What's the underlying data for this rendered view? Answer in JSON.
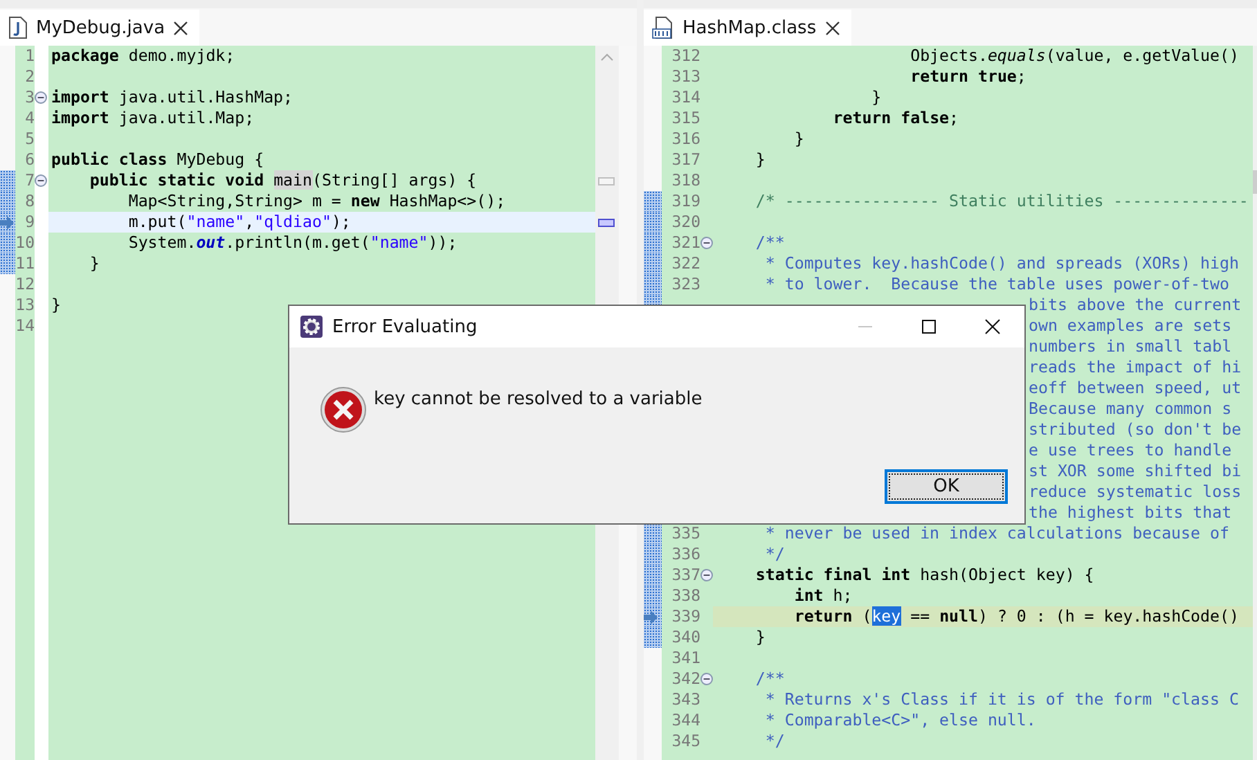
{
  "editors": [
    {
      "tab": {
        "title": "MyDebug.java",
        "kind": "java"
      },
      "scrollbar": {
        "kind": "overview"
      },
      "lines": [
        {
          "n": "1",
          "fold": false,
          "current": false,
          "scope": false,
          "parts": [
            {
              "text": "**package** demo.myjdk;",
              "kind": "code"
            }
          ]
        },
        {
          "n": "2",
          "fold": false,
          "current": false,
          "scope": false
        },
        {
          "n": "3",
          "fold": true,
          "current": false,
          "scope": false,
          "parts": [
            {
              "text": "**import** java.util.HashMap;",
              "kind": "code"
            }
          ]
        },
        {
          "n": "4",
          "fold": false,
          "current": false,
          "scope": false,
          "parts": [
            {
              "text": "**import** java.util.Map;",
              "kind": "code"
            }
          ]
        },
        {
          "n": "5",
          "fold": false,
          "current": false,
          "scope": false
        },
        {
          "n": "6",
          "fold": false,
          "current": false,
          "scope": false,
          "parts": [
            {
              "text": "**public** **class** MyDebug {",
              "kind": "code"
            }
          ]
        },
        {
          "n": "7",
          "fold": true,
          "current": false,
          "scope": true,
          "parts": [
            {
              "text": "    **public** **static** **void** ",
              "kind": "code"
            },
            {
              "text": "main",
              "kind": "occurrence"
            },
            {
              "text": "(String[] args) {",
              "kind": "code"
            }
          ]
        },
        {
          "n": "8",
          "fold": false,
          "current": false,
          "scope": true,
          "parts": [
            {
              "text": "        Map<String,String> m = **new** HashMap<>();",
              "kind": "code"
            }
          ]
        },
        {
          "n": "9",
          "fold": false,
          "current": true,
          "scope": true,
          "parts": [
            {
              "text": "        m.put(\"name\",\"qldiao\");",
              "kind": "code"
            }
          ]
        },
        {
          "n": "10",
          "fold": false,
          "current": false,
          "scope": true,
          "parts": [
            {
              "text": "        System.",
              "kind": "code"
            },
            {
              "text": "out",
              "kind": "field"
            },
            {
              "text": ".println(m.get(\"name\"));",
              "kind": "code"
            }
          ]
        },
        {
          "n": "11",
          "fold": false,
          "current": false,
          "scope": true,
          "parts": [
            {
              "text": "    }",
              "kind": "code"
            }
          ]
        },
        {
          "n": "12",
          "fold": false,
          "current": false,
          "scope": false
        },
        {
          "n": "13",
          "fold": false,
          "current": false,
          "scope": false,
          "parts": [
            {
              "text": "}",
              "kind": "code"
            }
          ]
        },
        {
          "n": "14",
          "fold": false,
          "current": false,
          "scope": false
        }
      ]
    },
    {
      "tab": {
        "title": "HashMap.class",
        "kind": "class"
      },
      "scrollbar": {
        "kind": "thumb"
      },
      "lines": [
        {
          "n": "312",
          "fold": false,
          "current": false,
          "scope": false,
          "parts": [
            {
              "text": "                    Objects.*equals*(value, e.getValue()",
              "kind": "code"
            }
          ]
        },
        {
          "n": "313",
          "fold": false,
          "current": false,
          "scope": false,
          "parts": [
            {
              "text": "                    **return** **true**;",
              "kind": "code"
            }
          ]
        },
        {
          "n": "314",
          "fold": false,
          "current": false,
          "scope": false,
          "parts": [
            {
              "text": "                }",
              "kind": "code"
            }
          ]
        },
        {
          "n": "315",
          "fold": false,
          "current": false,
          "scope": false,
          "parts": [
            {
              "text": "            **return** **false**;",
              "kind": "code"
            }
          ]
        },
        {
          "n": "316",
          "fold": false,
          "current": false,
          "scope": false,
          "parts": [
            {
              "text": "        }",
              "kind": "code"
            }
          ]
        },
        {
          "n": "317",
          "fold": false,
          "current": false,
          "scope": false,
          "parts": [
            {
              "text": "    }",
              "kind": "code"
            }
          ]
        },
        {
          "n": "318",
          "fold": false,
          "current": false,
          "scope": false
        },
        {
          "n": "319",
          "fold": false,
          "current": false,
          "scope": true,
          "parts": [
            {
              "text": "    /* ---------------- Static utilities --------------",
              "kind": "comment"
            }
          ]
        },
        {
          "n": "320",
          "fold": false,
          "current": false,
          "scope": true
        },
        {
          "n": "321",
          "fold": true,
          "current": false,
          "scope": true,
          "parts": [
            {
              "text": "    /**",
              "kind": "javadoc"
            }
          ]
        },
        {
          "n": "322",
          "fold": false,
          "current": false,
          "scope": true,
          "parts": [
            {
              "text": "     * Computes key.hashCode() and spreads (XORs) high",
              "kind": "javadoc"
            }
          ]
        },
        {
          "n": "323",
          "fold": false,
          "current": false,
          "scope": true,
          "parts": [
            {
              "text": "     * to lower.  Because the table uses power-of-two",
              "kind": "javadoc"
            }
          ]
        },
        {
          "fold": false,
          "current": false,
          "scope": true,
          "parts": [
            {
              "text": "bits above the current",
              "kind": "javadoc"
            }
          ]
        },
        {
          "fold": false,
          "current": false,
          "parts": [
            {
              "text": "own examples are sets",
              "kind": "javadoc"
            }
          ]
        },
        {
          "fold": false,
          "current": false,
          "parts": [
            {
              "text": "numbers in small tabl",
              "kind": "javadoc"
            }
          ]
        },
        {
          "fold": false,
          "current": false,
          "parts": [
            {
              "text": "reads the impact of hi",
              "kind": "javadoc"
            }
          ]
        },
        {
          "fold": false,
          "current": false,
          "parts": [
            {
              "text": "eoff between speed, ut",
              "kind": "javadoc"
            }
          ]
        },
        {
          "fold": false,
          "current": false,
          "parts": [
            {
              "text": "Because many common s",
              "kind": "javadoc"
            }
          ]
        },
        {
          "fold": false,
          "current": false,
          "parts": [
            {
              "text": "stributed (so don't be",
              "kind": "javadoc"
            }
          ]
        },
        {
          "fold": false,
          "current": false,
          "parts": [
            {
              "text": "e use trees to handle",
              "kind": "javadoc"
            }
          ]
        },
        {
          "fold": false,
          "current": false,
          "parts": [
            {
              "text": "st XOR some shifted bi",
              "kind": "javadoc"
            }
          ]
        },
        {
          "fold": false,
          "current": false,
          "parts": [
            {
              "text": "reduce systematic loss",
              "kind": "javadoc"
            }
          ]
        },
        {
          "fold": false,
          "current": false,
          "parts": [
            {
              "text": "the highest bits that",
              "kind": "javadoc"
            }
          ]
        },
        {
          "n": "335",
          "fold": false,
          "current": false,
          "scope": true,
          "parts": [
            {
              "text": "     * never be used in index calculations because of",
              "kind": "javadoc"
            }
          ]
        },
        {
          "n": "336",
          "fold": false,
          "current": false,
          "scope": true,
          "parts": [
            {
              "text": "     */",
              "kind": "javadoc"
            }
          ]
        },
        {
          "n": "337",
          "fold": true,
          "current": false,
          "scope": true,
          "parts": [
            {
              "text": "    **static** **final** **int** hash(Object key) {",
              "kind": "code"
            }
          ]
        },
        {
          "n": "338",
          "fold": false,
          "current": false,
          "scope": true,
          "parts": [
            {
              "text": "        **int** h;",
              "kind": "code"
            }
          ]
        },
        {
          "n": "339",
          "fold": false,
          "current": true,
          "scope": true,
          "parts": [
            {
              "text": "        **return** (",
              "kind": "code"
            },
            {
              "text": "key",
              "kind": "selected"
            },
            {
              "text": " == **null**) ? 0 : (h = key.hashCode()",
              "kind": "code"
            }
          ]
        },
        {
          "n": "340",
          "fold": false,
          "current": false,
          "scope": true,
          "parts": [
            {
              "text": "    }",
              "kind": "code"
            }
          ]
        },
        {
          "n": "341",
          "fold": false,
          "current": false,
          "scope": false
        },
        {
          "n": "342",
          "fold": true,
          "current": false,
          "scope": false,
          "parts": [
            {
              "text": "    /**",
              "kind": "javadoc"
            }
          ]
        },
        {
          "n": "343",
          "fold": false,
          "current": false,
          "scope": false,
          "parts": [
            {
              "text": "     * Returns x's Class if it is of the form \"class C",
              "kind": "javadoc"
            }
          ]
        },
        {
          "n": "344",
          "fold": false,
          "current": false,
          "scope": false,
          "parts": [
            {
              "text": "     * Comparable<C>\", else null.",
              "kind": "javadoc"
            }
          ]
        },
        {
          "n": "345",
          "fold": false,
          "current": false,
          "scope": false,
          "parts": [
            {
              "text": "     */",
              "kind": "javadoc"
            }
          ]
        }
      ]
    }
  ],
  "dialog": {
    "title": "Error Evaluating",
    "window_buttons": [
      {
        "kind": "minimize",
        "disabled": true
      },
      {
        "kind": "maximize",
        "disabled": false
      },
      {
        "kind": "close",
        "disabled": false
      }
    ],
    "message": "key cannot be resolved to a variable",
    "button": {
      "label": "OK",
      "focused": true
    }
  }
}
